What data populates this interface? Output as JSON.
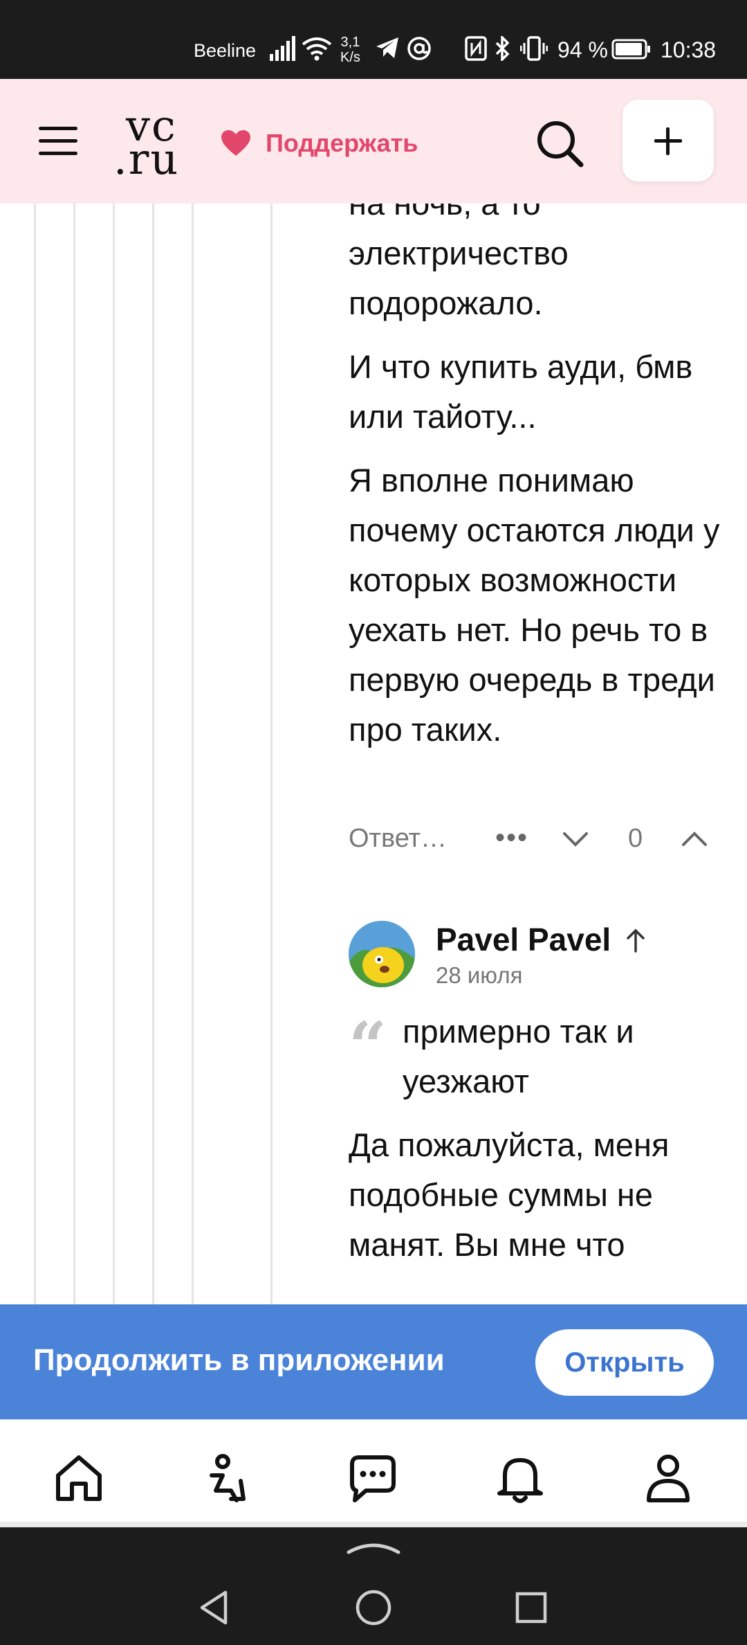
{
  "status_bar": {
    "carrier": "Beeline",
    "speed_value": "3,1",
    "speed_unit": "K/s",
    "battery": "94 %",
    "time": "10:38"
  },
  "header": {
    "logo_line1": "vc",
    "logo_line2": ".ru",
    "support_label": "Поддержать",
    "accent_color": "#e2476b",
    "background_color": "#fde8eb"
  },
  "comment1": {
    "paragraphs": [
      "на ночь, а то электричество подорожало.",
      "И что купить ауди, бмв или тайоту...",
      "Я вполне понимаю почему остаются люди у которых возможности уехать нет. Но речь то в первую очередь в треди про таких."
    ],
    "reply_label": "Ответ…",
    "more_label": "•••",
    "rating": "0"
  },
  "comment2": {
    "author": "Pavel Pavel",
    "date": "28 июля",
    "quote": "примерно так и уезжают",
    "text": "Да пожалуйста, меня подобные суммы не манят. Вы мне что"
  },
  "app_banner": {
    "label": "Продолжить в приложении",
    "button": "Открыть",
    "color": "#4a83d8"
  },
  "bottom_nav": {
    "items": [
      "home-icon",
      "popular-icon",
      "messages-icon",
      "notifications-icon",
      "profile-icon"
    ]
  },
  "system_nav": {
    "items": [
      "back-icon",
      "home-circle-icon",
      "recents-icon"
    ]
  }
}
